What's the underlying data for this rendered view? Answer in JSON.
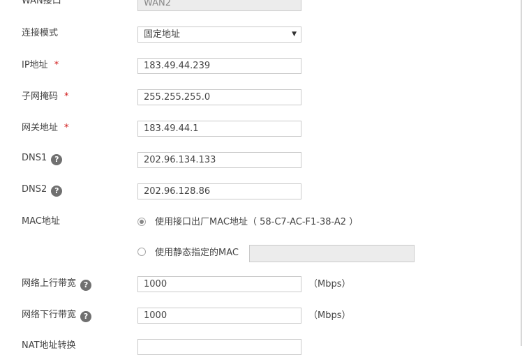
{
  "wan_interface": {
    "label": "WAN接口",
    "value": "WAN2"
  },
  "connection_mode": {
    "label": "连接模式",
    "value": "固定地址"
  },
  "ip": {
    "label": "IP地址",
    "required_mark": "*",
    "value": "183.49.44.239"
  },
  "subnet": {
    "label": "子网掩码",
    "required_mark": "*",
    "value": "255.255.255.0"
  },
  "gateway": {
    "label": "网关地址",
    "required_mark": "*",
    "value": "183.49.44.1"
  },
  "dns1": {
    "label": "DNS1",
    "help": "?",
    "value": "202.96.134.133"
  },
  "dns2": {
    "label": "DNS2",
    "help": "?",
    "value": "202.96.128.86"
  },
  "mac": {
    "label": "MAC地址",
    "option_factory": "使用接口出厂MAC地址（  58-C7-AC-F1-38-A2  ）",
    "option_static": "使用静态指定的MAC",
    "static_value": ""
  },
  "upstream": {
    "label": "网络上行带宽",
    "help": "?",
    "value": "1000",
    "unit": "（Mbps）"
  },
  "downstream": {
    "label": "网络下行带宽",
    "help": "?",
    "value": "1000",
    "unit": "（Mbps）"
  },
  "nat": {
    "label": "NAT地址转换"
  }
}
